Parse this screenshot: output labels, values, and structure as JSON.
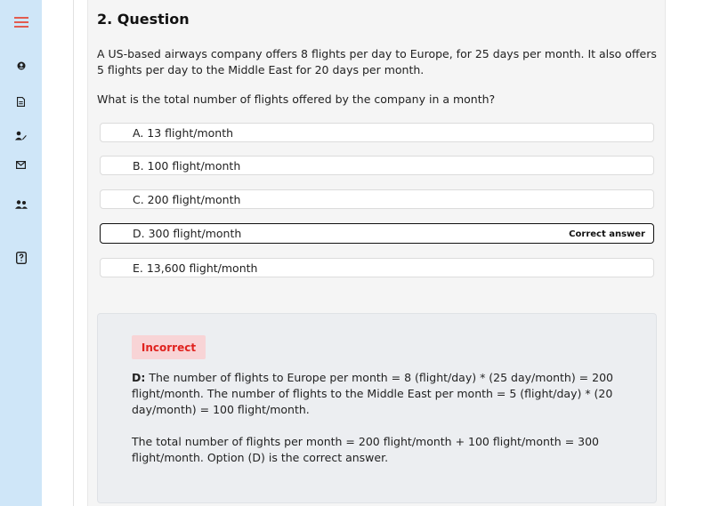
{
  "sidebar": {
    "accent_color": "#e25b4f",
    "background_color": "#cfe6f8",
    "icons": [
      "menu-icon",
      "user-icon",
      "document-icon",
      "user-edit-icon",
      "mail-icon",
      "users-icon",
      "quiz-icon"
    ]
  },
  "question": {
    "title": "2. Question",
    "text": "A US-based airways company offers 8 flights per day to Europe, for 25 days per month. It also offers 5 flights per day to the Middle East for 20 days per month.",
    "prompt": "What is the total number of flights offered by the company in a month?",
    "options": [
      {
        "label": "A. 13 flight/month"
      },
      {
        "label": "B. 100 flight/month"
      },
      {
        "label": "C. 200 flight/month"
      },
      {
        "label": "D. 300 flight/month",
        "tag": "Correct answer"
      },
      {
        "label": "E. 13,600 flight/month"
      }
    ]
  },
  "explanation": {
    "status": "Incorrect",
    "status_color": "#e0231f",
    "lead": "D:",
    "paragraph1": " The number of flights to Europe per month = 8 (flight/day) * (25 day/month) = 200 flight/month. The number of flights to the Middle East per month = 5 (flight/day) * (20 day/month) =  100 flight/month.",
    "paragraph2": "The total number of flights per month = 200 flight/month + 100 flight/month = 300 flight/month. Option (D) is the correct answer."
  }
}
